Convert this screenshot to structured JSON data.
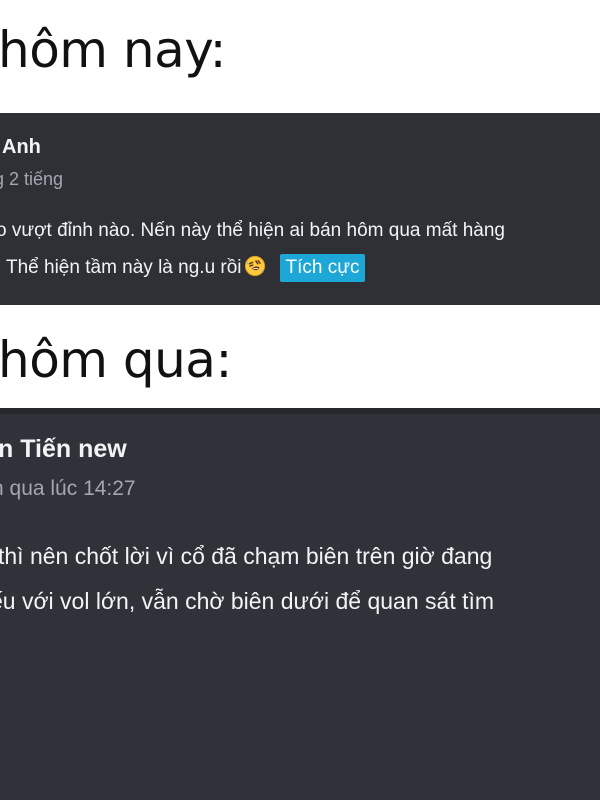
{
  "headings": {
    "today": "hôm nay:",
    "yesterday": "hôm qua:"
  },
  "posts": [
    {
      "author": "Anh",
      "time": "g 2 tiếng",
      "lines": [
        "o vượt đỉnh nào. Nến này thể hiện ai bán hôm qua mất hàng",
        "Thể hiện tầm này là ng.u rồi"
      ],
      "emoji": "rolling-on-floor-laughing-emoji",
      "sentiment_tag": "Tích cực",
      "tag_color": "#1ca7d6"
    },
    {
      "author": "n Tiến new",
      "time": "n qua lúc 14:27",
      "lines": [
        " thì nên chốt lời vì cổ đã chạm biên trên giờ đang",
        "ếu với vol lớn, vẫn chờ biên dưới để quan sát tìm"
      ]
    }
  ],
  "colors": {
    "card_background": "#2e3036",
    "card_text": "#f2f3f5",
    "muted_text": "#a3a6ad",
    "page_background": "#ffffff"
  }
}
